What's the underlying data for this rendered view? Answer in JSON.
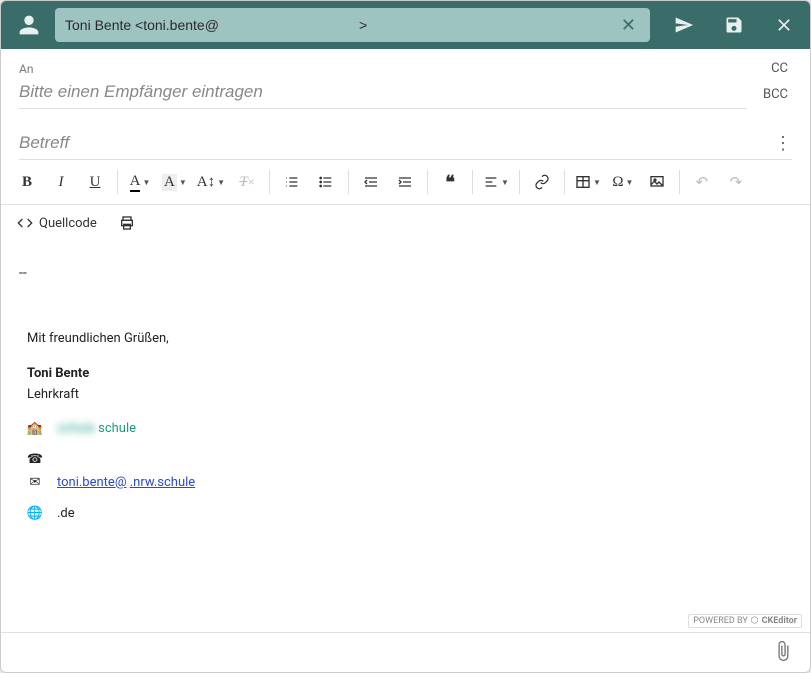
{
  "header": {
    "from": "Toni Bente <toni.bente@                                    >",
    "send_label": "Senden",
    "save_label": "Speichern",
    "close_label": "Schließen"
  },
  "recipients": {
    "to_label": "An",
    "to_placeholder": "Bitte einen Empfänger eintragen",
    "cc_label": "CC",
    "bcc_label": "BCC"
  },
  "subject": {
    "placeholder": "Betreff",
    "value": ""
  },
  "toolbar": {
    "bold": "B",
    "italic": "I",
    "underline": "U",
    "fontcolor": "A",
    "bgcolor": "A",
    "fontsize": "A",
    "quellcode": "Quellcode"
  },
  "body": {
    "separator": "--",
    "greeting": "Mit freundlichen Grüßen,",
    "name": "Toni Bente",
    "role": "Lehrkraft",
    "school_part1": "         schule ",
    "school_part2": "                  ",
    "phone": "                 ",
    "email_prefix": "toni.bente@",
    "email_mid": "                    ",
    "email_suffix": ".nrw.schule",
    "web_prefix": "                  ",
    "web_suffix": ".de"
  },
  "footer": {
    "powered_prefix": "POWERED BY",
    "powered_name": "CKEditor"
  }
}
